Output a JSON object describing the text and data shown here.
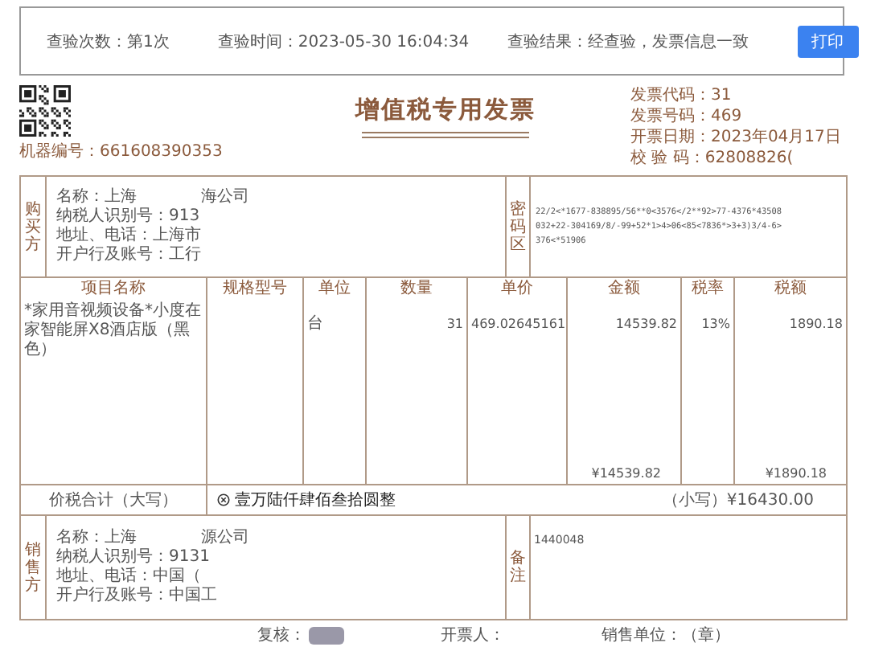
{
  "check_bar": {
    "count": "查验次数：第1次",
    "time": "查验时间：2023-05-30 16:04:34",
    "result": "查验结果：经查验，发票信息一致",
    "print_button": "打印"
  },
  "invoice": {
    "title": "增值税专用发票",
    "machine_no": "机器编号：661608390353",
    "meta": [
      "发票代码：31",
      "发票号码：469",
      "开票日期：2023年04月17日",
      "校 验 码：62808826("
    ],
    "buyer": {
      "label": "购买方",
      "lines": [
        [
          "名称：上海",
          "海公司"
        ],
        [
          "纳税人识别号：913"
        ],
        [
          "地址、电话：上海市"
        ],
        [
          "开户行及账号：工行"
        ]
      ]
    },
    "cipher": {
      "label": "密码区",
      "lines": [
        "22/2<*1677-838895/56**0<3576</2**92>77-4376*43508",
        "032+22-304169/8/-99+52*1>4>06<85<7836*>3+3)3/4-6>",
        "376<*51906"
      ]
    },
    "columns": [
      "项目名称",
      "规格型号",
      "单位",
      "数量",
      "单价",
      "金额",
      "税率",
      "税额"
    ],
    "rows": [
      [
        "*家用音视频设备*小度在家智能屏X8酒店版（黑色）",
        "",
        "台",
        "31",
        "469.02645161",
        "14539.82",
        "13%",
        "1890.18"
      ]
    ],
    "totals": {
      "amount": "¥14539.82",
      "tax": "¥1890.18"
    },
    "grand_total": {
      "label": "价税合计（大写）",
      "words": "壹万陆仟肆佰叁拾圆整",
      "figures": "（小写）¥16430.00"
    },
    "seller": {
      "label": "销售方",
      "lines": [
        [
          "名称：上海",
          "源公司"
        ],
        [
          "纳税人识别号：9131"
        ],
        [
          "地址、电话：中国（"
        ],
        [
          "开户行及账号：中国工"
        ]
      ]
    },
    "remarks": {
      "label": "备注",
      "text": "1440048"
    },
    "footer": [
      {
        "label": "复核：",
        "redacted": true
      },
      {
        "label": "开票人：",
        "redacted": false
      },
      {
        "label": "销售单位：（章）",
        "redacted": false
      }
    ]
  }
}
